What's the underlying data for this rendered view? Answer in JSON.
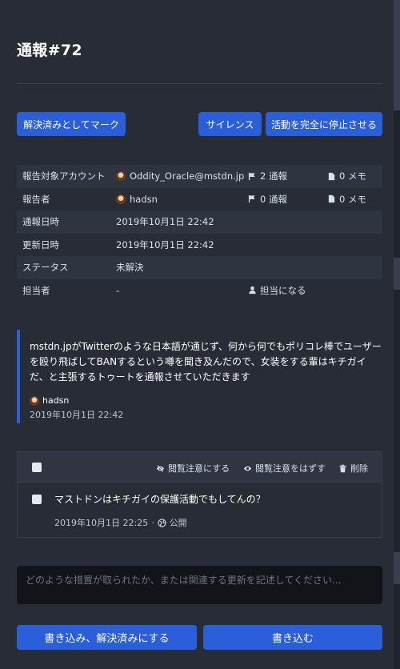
{
  "header": {
    "title": "通報#72"
  },
  "actions": {
    "resolve": "解決済みとしてマーク",
    "silence": "サイレンス",
    "suspend": "活動を完全に停止させる"
  },
  "info": {
    "rows": [
      {
        "label": "報告対象アカウント",
        "value": "Oddity_Oracle@mstdn.jp",
        "reports": "2 通報",
        "notes": "0 メモ"
      },
      {
        "label": "報告者",
        "value": "hadsn",
        "reports": "0 通報",
        "notes": "0 メモ"
      },
      {
        "label": "通報日時",
        "value": "2019年10月1日 22:42"
      },
      {
        "label": "更新日時",
        "value": "2019年10月1日 22:42"
      },
      {
        "label": "ステータス",
        "value": "未解決"
      },
      {
        "label": "担当者",
        "value": "-",
        "assign": "担当になる"
      }
    ]
  },
  "report": {
    "comment": "mstdn.jpがTwitterのような日本語が通じず、何から何でもポリコレ棒でユーザーを殴り飛ばしてBANするという噂を聞き及んだので、女装をする輩はキチガイだ、と主張するトゥートを通報させていただきます",
    "author": "hadsn",
    "date": "2019年10月1日 22:42"
  },
  "statuses": {
    "actions": {
      "sensitive": "閲覧注意にする",
      "unsensitive": "閲覧注意をはずす",
      "delete": "削除"
    },
    "items": [
      {
        "text": "マストドンはキチガイの保護活動でもしてんの？",
        "date": "2019年10月1日 22:25",
        "separator": "·",
        "visibility": "公開"
      }
    ]
  },
  "note": {
    "placeholder": "どのような措置が取られたか、または関連する更新を記述してください..."
  },
  "submit": {
    "resolve": "書き込み、解決済みにする",
    "write": "書き込む"
  },
  "colors": {
    "accent": "#2b5fd9",
    "background": "#282c37"
  }
}
